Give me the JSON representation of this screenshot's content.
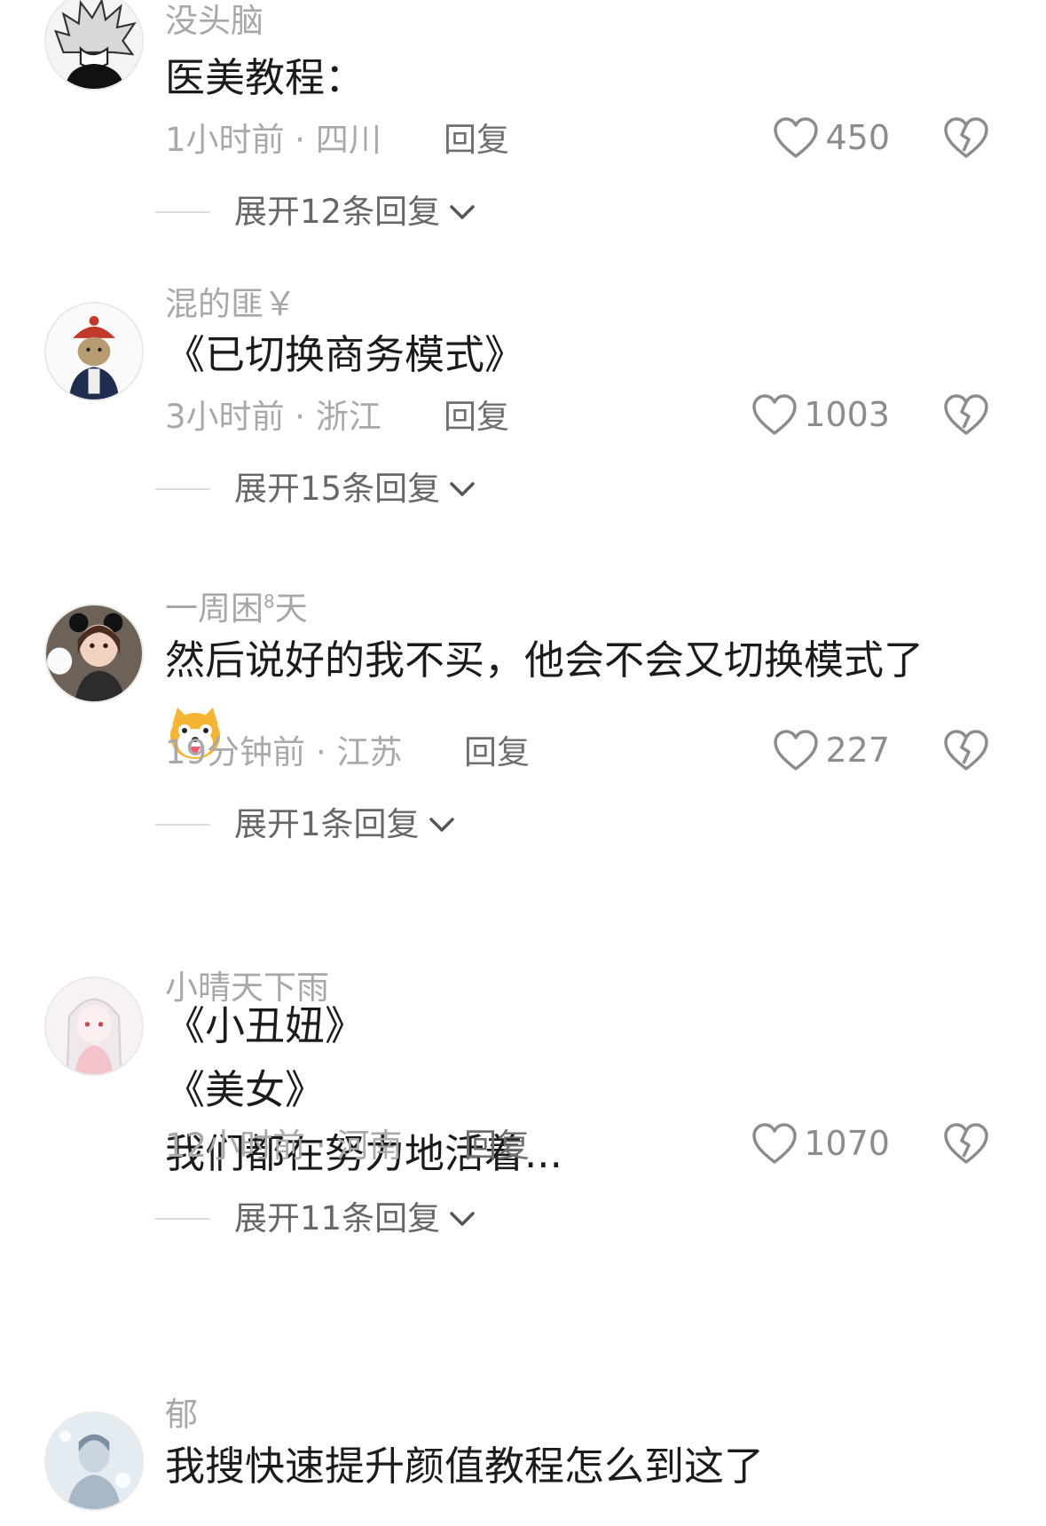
{
  "comments": [
    {
      "username": "没头脑",
      "content_lines": [
        "医美教程："
      ],
      "time": "1小时前",
      "location": "四川",
      "reply_label": "回复",
      "likes": "450",
      "expand_label": "展开12条回复"
    },
    {
      "username": "混的匪￥",
      "content_lines": [
        "《已切换商务模式》"
      ],
      "time": "3小时前",
      "location": "浙江",
      "reply_label": "回复",
      "likes": "1003",
      "expand_label": "展开15条回复"
    },
    {
      "username_main": "一周困",
      "username_sup": "8",
      "username_tail": "天",
      "content_lines": [
        "然后说好的我不买，他会不会又切换模式了"
      ],
      "emoji": "dog-tongue-emoji",
      "time": "19分钟前",
      "location": "江苏",
      "reply_label": "回复",
      "likes": "227",
      "expand_label": "展开1条回复"
    },
    {
      "username": "小晴天下雨",
      "content_lines": [
        "《小丑妞》",
        "《美女》",
        "我们都在努力地活着..."
      ],
      "time": "12小时前",
      "location": "河南",
      "reply_label": "回复",
      "likes": "1070",
      "expand_label": "展开11条回复"
    },
    {
      "username": "郁",
      "content_lines": [
        "我搜快速提升颜值教程怎么到这了"
      ]
    }
  ],
  "separator": " · ",
  "colors": {
    "meta": "#a9a9a9",
    "text": "#1b1b1b",
    "icon": "#8c8c8c"
  }
}
